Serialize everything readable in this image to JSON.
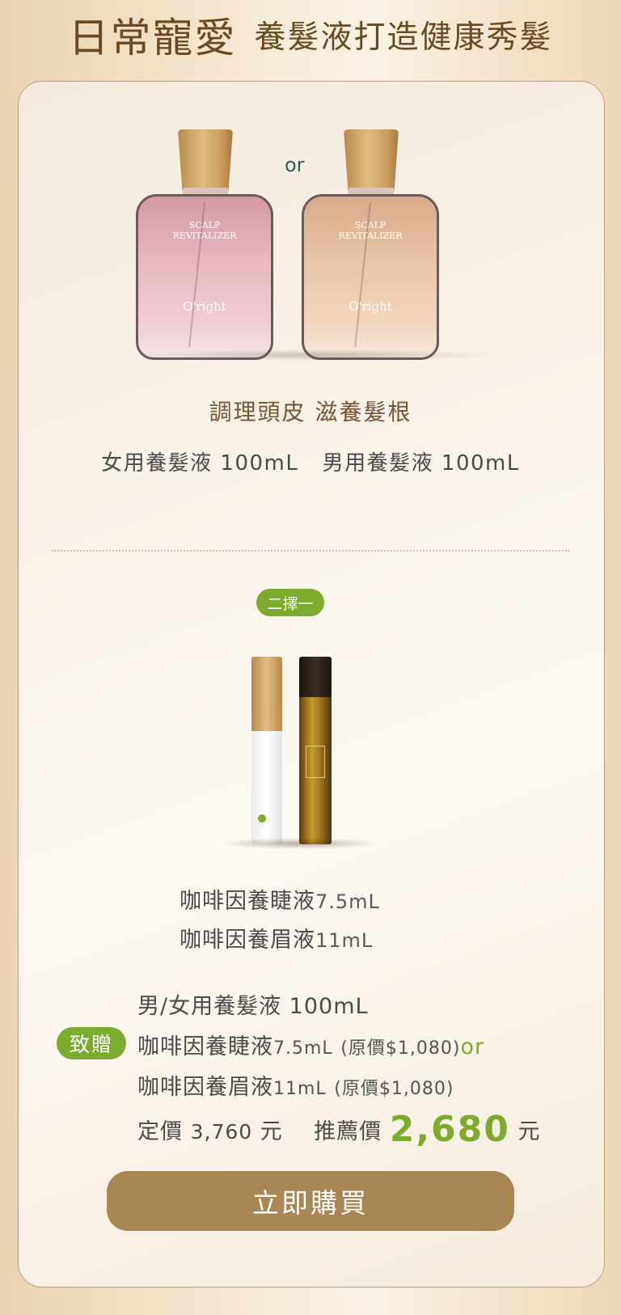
{
  "header": {
    "title_big": "日常寵愛",
    "title_sub": "養髮液打造健康秀髮"
  },
  "hero": {
    "bottles": [
      {
        "label_line1": "SCALP",
        "label_line2": "REVITALIZER",
        "brand": "O'right"
      },
      {
        "label_line1": "SCALP",
        "label_line2": "REVITALIZER",
        "brand": "O'right"
      }
    ],
    "or_text": "or",
    "subhead": "調理頭皮 滋養髮根",
    "products_line": "女用養髮液 100mL   男用養髮液 100mL"
  },
  "choice": {
    "pill": "二擇一",
    "serum_1_name": "咖啡因養睫液",
    "serum_1_size": "7.5mL",
    "serum_2_name": "咖啡因養眉液",
    "serum_2_size": "11mL"
  },
  "offer": {
    "gift_badge": "致贈",
    "line1": "男/女用養髮液 100mL",
    "line2_name": "咖啡因養睫液",
    "line2_size": "7.5mL",
    "line2_price": "(原價$1,080)",
    "line2_or": "or",
    "line3_name": "咖啡因養眉液",
    "line3_size": "11mL",
    "line3_price": "(原價$1,080)",
    "list_price_label": "定價",
    "list_price": "3,760",
    "list_price_unit": "元",
    "rec_price_label": "推薦價",
    "rec_price": "2,680",
    "rec_price_unit": "元"
  },
  "cta": {
    "buy_label": "立即購買"
  },
  "colors": {
    "accent_green": "#7dab2d",
    "button_brown": "#a98755",
    "title_brown": "#6b4a20"
  }
}
